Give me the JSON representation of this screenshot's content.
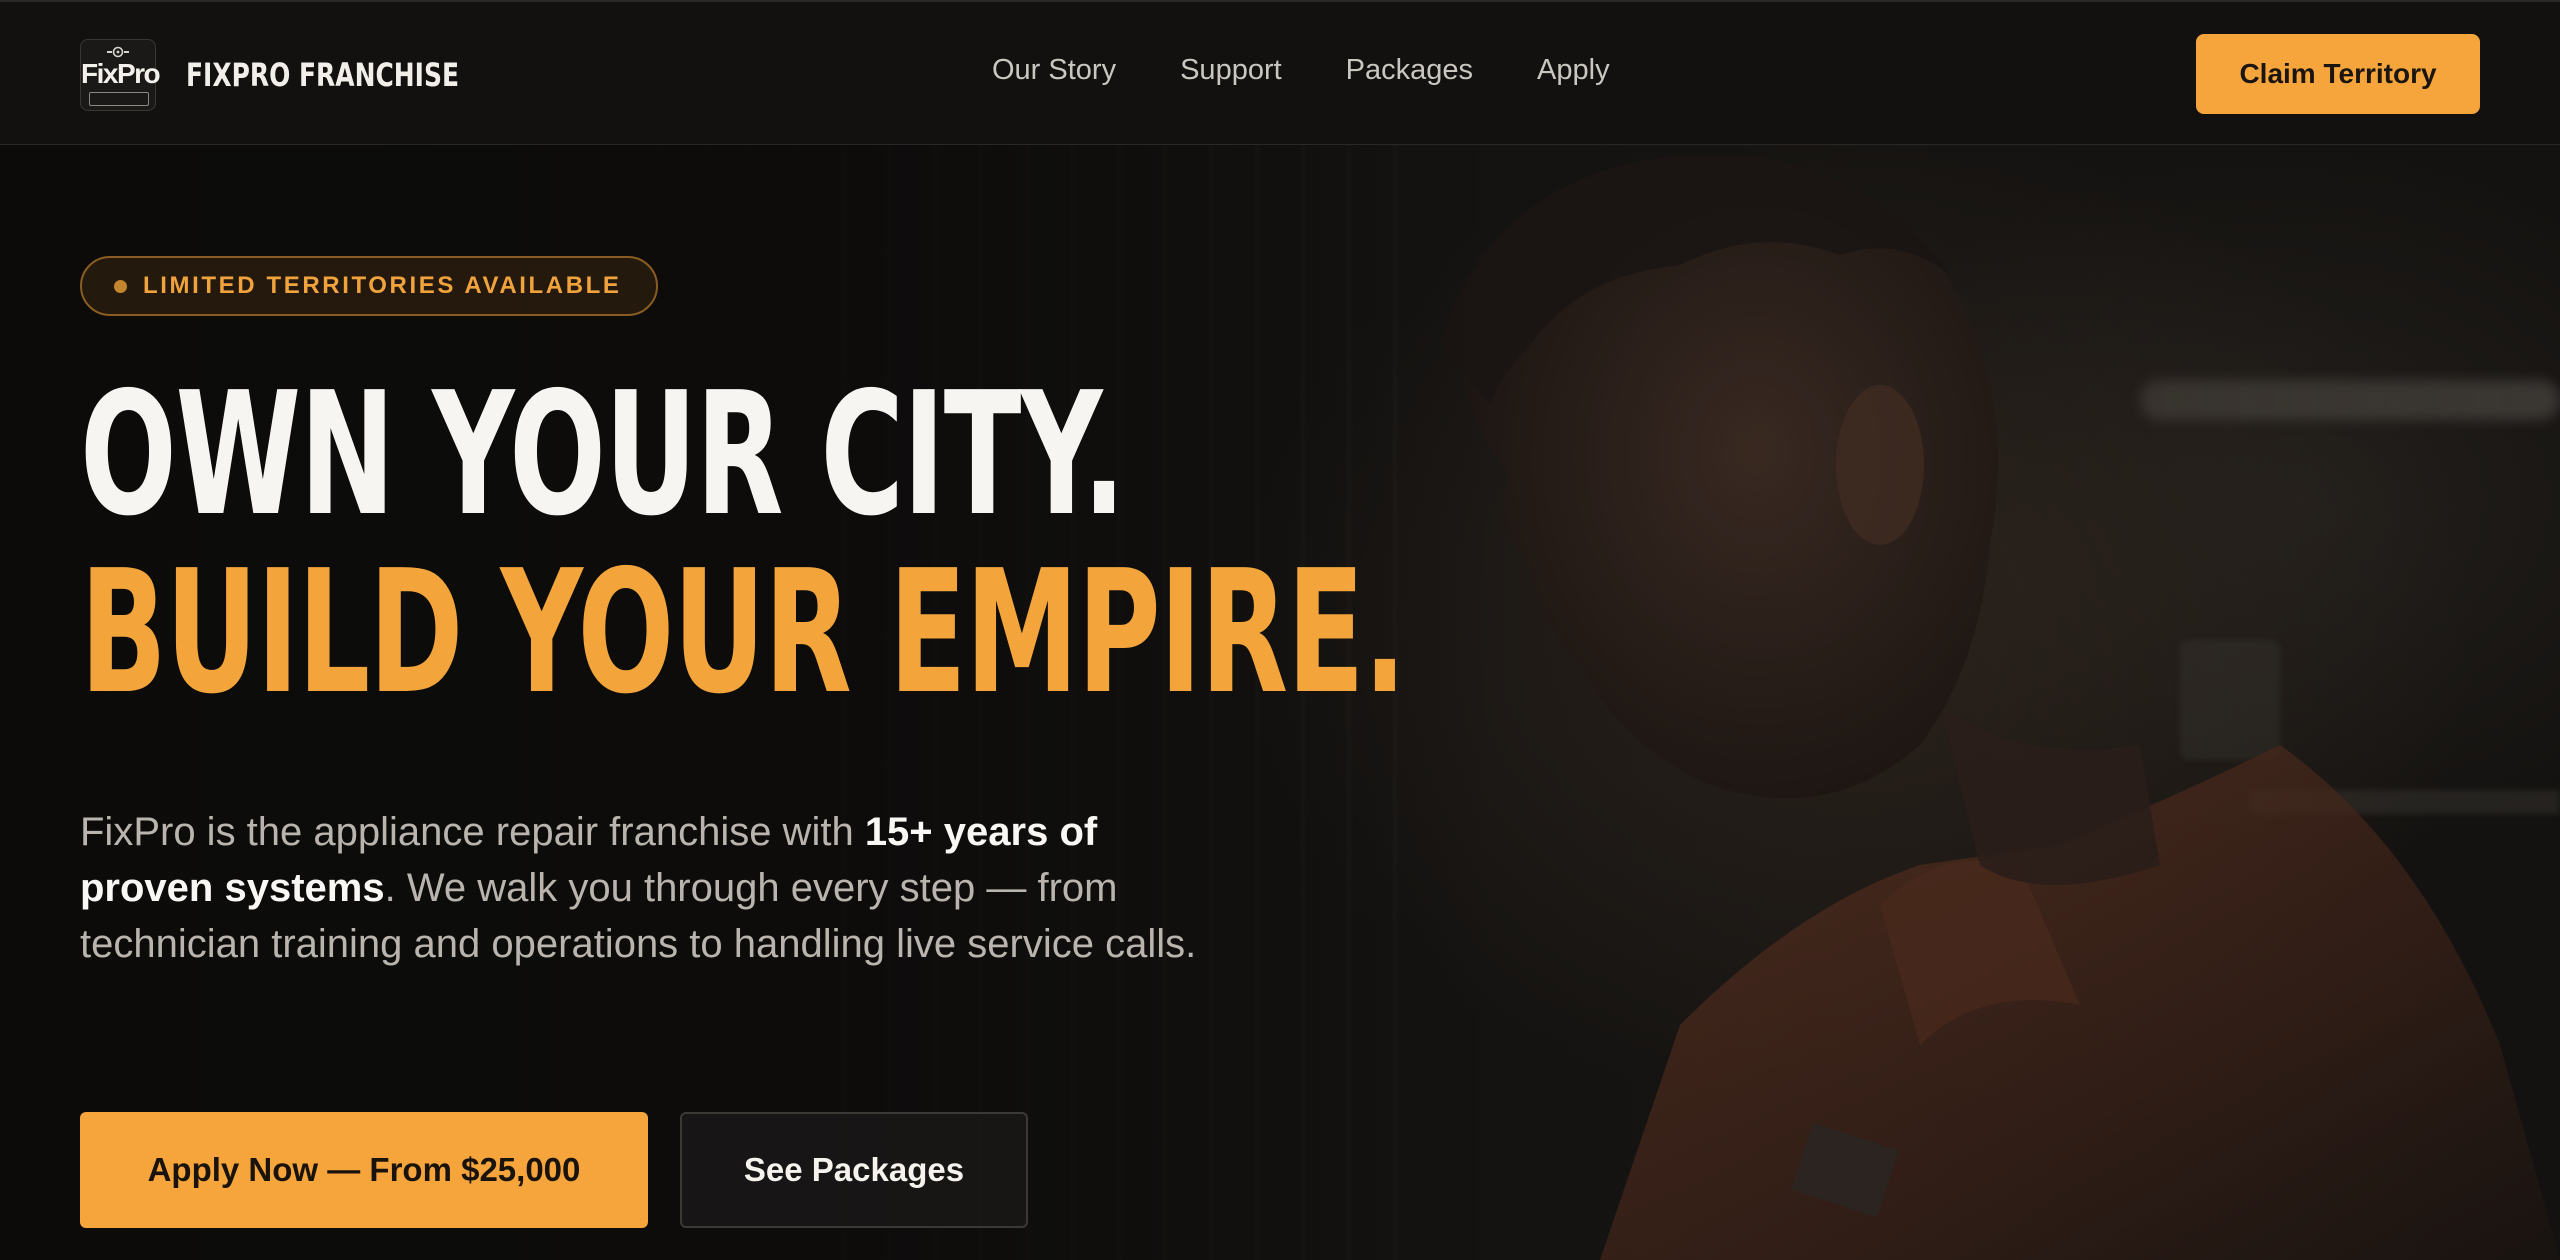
{
  "nav": {
    "brand_name": "FIXPRO FRANCHISE",
    "logo_text": "FixPro",
    "links": [
      {
        "label": "Our Story"
      },
      {
        "label": "Support"
      },
      {
        "label": "Packages"
      },
      {
        "label": "Apply"
      }
    ],
    "cta_label": "Claim Territory"
  },
  "hero": {
    "badge": "LIMITED TERRITORIES AVAILABLE",
    "headline_line1": "OWN YOUR CITY.",
    "headline_line2": "BUILD YOUR EMPIRE.",
    "lede": {
      "part1": "FixPro is the appliance repair franchise with ",
      "highlight": "15+ years of proven systems",
      "part2": ". We walk you through every step — from technician training and operations to handling live service calls."
    },
    "primary_cta": "Apply Now — From $25,000",
    "secondary_cta": "See Packages"
  },
  "colors": {
    "accent": "#f5a53c",
    "background": "#0e0d0c",
    "nav_background": "#121110",
    "headline_white": "#f7f5f1",
    "body_text": "#b9b4ad"
  },
  "icons": {
    "logo": "fixpro-gear-logo-icon",
    "badge_dot": "status-dot-icon"
  }
}
